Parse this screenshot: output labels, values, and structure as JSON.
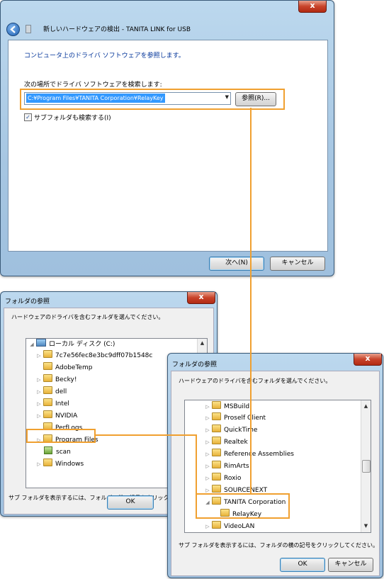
{
  "wizard": {
    "title": "新しいハードウェアの検出 - TANITA LINK for USB",
    "heading": "コンピュータ上のドライバ ソフトウェアを参照します。",
    "search_label": "次の場所でドライバ ソフトウェアを検索します:",
    "path_value": "C:¥Program Files¥TANITA Corporation¥RelayKey",
    "browse_label": "参照(R)...",
    "include_subfolders_label": "サブフォルダも検索する(I)",
    "include_subfolders_checked": true,
    "next_label": "次へ(N)",
    "cancel_label": "キャンセル",
    "close_glyph": "x"
  },
  "browse1": {
    "title": "フォルダの参照",
    "instruction": "ハードウェアのドライバを含むフォルダを選んでください。",
    "items": [
      {
        "label": "ローカル ディスク (C:)",
        "icon": "drive-icon"
      },
      {
        "label": "7c7e56fec8e3bc9dff07b1548c"
      },
      {
        "label": "AdobeTemp"
      },
      {
        "label": "Becky!"
      },
      {
        "label": "dell"
      },
      {
        "label": "Intel"
      },
      {
        "label": "NVIDIA"
      },
      {
        "label": "PerfLogs"
      },
      {
        "label": "Program Files"
      },
      {
        "label": "scan"
      },
      {
        "label": "Windows"
      }
    ],
    "hint": "サブ フォルダを表示するには、フォルダの横の記号をクリックしてください。",
    "ok_label": "OK",
    "close_glyph": "x"
  },
  "browse2": {
    "title": "フォルダの参照",
    "instruction": "ハードウェアのドライバを含むフォルダを選んでください。",
    "items": [
      {
        "label": "MSBuild"
      },
      {
        "label": "Proself Client"
      },
      {
        "label": "QuickTime"
      },
      {
        "label": "Realtek"
      },
      {
        "label": "Reference Assemblies"
      },
      {
        "label": "RimArts"
      },
      {
        "label": "Roxio"
      },
      {
        "label": "SOURCENEXT"
      },
      {
        "label": "TANITA Corporation"
      },
      {
        "label": "RelayKey"
      },
      {
        "label": "VideoLAN"
      }
    ],
    "hint": "サブ フォルダを表示するには、フォルダの横の記号をクリックしてください。",
    "ok_label": "OK",
    "cancel_label": "キャンセル",
    "close_glyph": "x"
  },
  "colors": {
    "highlight": "#f0a030",
    "selection": "#3399ff",
    "close": "#c8432a"
  }
}
